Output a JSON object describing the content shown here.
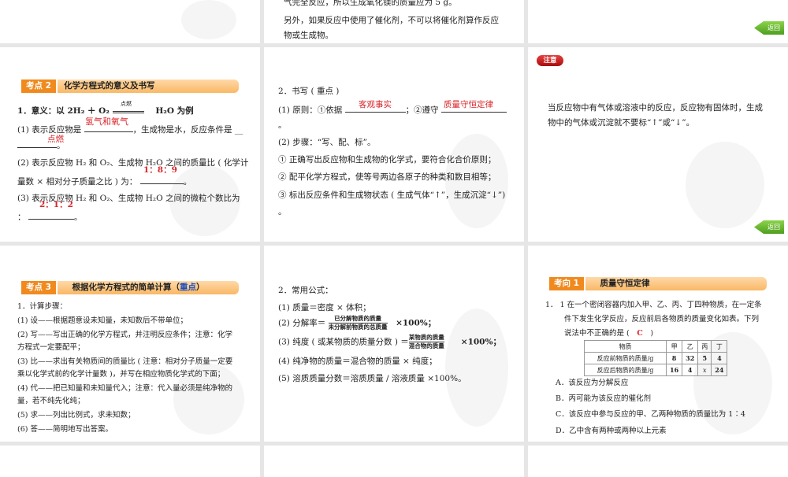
{
  "slide_top_mid": {
    "line1": "气完全反应，所以生成氧化镁的质量应为 5 g。",
    "line2": "另外，如果反应中使用了催化剂，不可以将催化剂算作反应",
    "line3": "物或生成物。"
  },
  "return_label": "返回",
  "slide_a": {
    "badge": "考点 2",
    "title": "化学方程式的意义及书写",
    "eq_pre": "1．意义：以 2H₂ ＋ O₂",
    "eq_cond": "点燃",
    "eq_post": "H₂O 为例",
    "p1a": "(1) 表示反应物是",
    "p1b": "，生成物是水，反应条件是 __",
    "p1_ans1": "氢气和氧气",
    "p1_ans2": "点燃",
    "p1c": "。",
    "p2a": "(2) 表示反应物 H₂ 和 O₂、生成物 H₂O 之间的质量比 ( 化学计",
    "p2b": "量数 × 相对分子质量之比 ) 为：",
    "p2_ans": "1：8：9",
    "p2c": "。",
    "p3a": "(3) 表示反应物 H₂ 和 O₂、生成物 H₂O 之间的微粒个数比为",
    "p3b": "：",
    "p3_ans": "2：1：2",
    "p3c": "。"
  },
  "slide_b": {
    "l1": "2．书写 ( 重点 )",
    "l2a": "(1) 原则：①依据",
    "l2_ans1": "客观事实",
    "l2b": "；②遵守",
    "l2_ans2": "质量守恒定律",
    "l3": "。",
    "l4": "(2) 步骤：“写、配、标”。",
    "l5": "① 正确写出反应物和生成物的化学式，要符合化合价原则；",
    "l6": "② 配平化学方程式，使等号两边各原子的种类和数目相等；",
    "l7": "③ 标出反应条件和生成物状态 ( 生成气体“↑”，生成沉淀“↓”)",
    "l8": "。"
  },
  "slide_c": {
    "badge": "注意",
    "l1": "当反应物中有气体或溶液中的反应，反应物有固体时，生成",
    "l2": "物中的气体或沉淀就不要标“↑”或“↓”。"
  },
  "slide_d": {
    "badge": "考点 3",
    "title": "根据化学方程式的简单计算（",
    "title_em": "重点",
    "title_end": "）",
    "lines": [
      "1．计算步骤：",
      "(1) 设——根据题意设未知量，未知数后不带单位；",
      "(2) 写——写出正确的化学方程式，并注明反应条件；注意：化学",
      "方程式一定要配平；",
      "(3) 比——求出有关物质间的质量比 ( 注意：相对分子质量一定要",
      "乘以化学式前的化学计量数 )，并写在相应物质化学式的下面；",
      "(4) 代——把已知量和未知量代入；注意：代入量必须是纯净物的",
      "量，若不纯先化纯；",
      "(5) 求——列出比例式，求未知数；",
      "(6) 答——简明地写出答案。"
    ]
  },
  "slide_e": {
    "l1": "2．常用公式：",
    "l2": "(1) 质量＝密度 × 体积；",
    "l3a": "(2) 分解率＝",
    "l3_num": "已分解物质的质量",
    "l3_den": "未分解前物质的总质量",
    "l3b": "×100%；",
    "l4a": "(3) 纯度 ( 或某物质的质量分数 ) ＝",
    "l4_num": "某物质的质量",
    "l4_den": "混合物的质量",
    "l4b": "×100%；",
    "l5": "(4) 纯净物的质量＝混合物的质量 × 纯度；",
    "l6": "(5) 溶质质量分数＝溶质质量 / 溶液质量 ×100%。"
  },
  "slide_f": {
    "badge": "考向 1",
    "title": "质量守恒定律",
    "q1": "1． 1 在一个密闭容器内加入甲、乙、丙、丁四种物质，在一定条",
    "q2": "件下发生化学反应，反应前后各物质的质量变化如表。下列",
    "q3a": "说法中不正确的是 (",
    "q3_ans": "C",
    "q3b": ")",
    "table": {
      "header": [
        "物质",
        "甲",
        "乙",
        "丙",
        "丁"
      ],
      "rows": [
        [
          "反应前物质的质量/g",
          "8",
          "32",
          "5",
          "4"
        ],
        [
          "反应后物质的质量/g",
          "16",
          "4",
          "x",
          "24"
        ]
      ]
    },
    "options": [
      "A．该反应为分解反应",
      "B．丙可能为该反应的催化剂",
      "C．该反应中参与反应的甲、乙两种物质的质量比为 1∶4",
      "D．乙中含有两种或两种以上元素"
    ]
  }
}
